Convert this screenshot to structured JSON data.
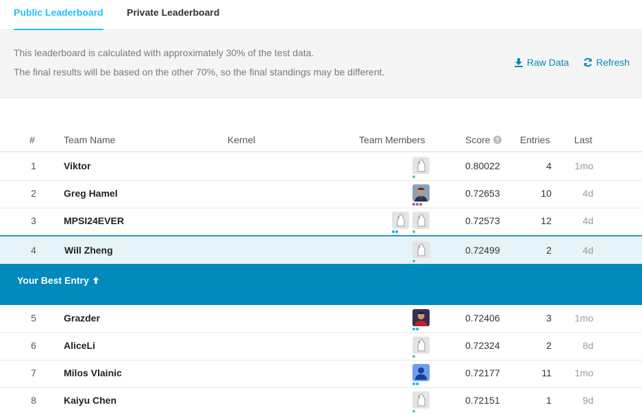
{
  "tabs": {
    "public": "Public Leaderboard",
    "private": "Private Leaderboard"
  },
  "info": {
    "line1": "This leaderboard is calculated with approximately 30% of the test data.",
    "line2": "The final results will be based on the other 70%, so the final standings may be different.",
    "raw_data": "Raw Data",
    "refresh": "Refresh"
  },
  "columns": {
    "rank": "#",
    "team_name": "Team Name",
    "kernel": "Kernel",
    "team_members": "Team Members",
    "score": "Score",
    "entries": "Entries",
    "last": "Last"
  },
  "best_entry_label": "Your Best Entry",
  "rows": [
    {
      "rank": "1",
      "name": "Viktor",
      "score": "0.80022",
      "entries": "4",
      "last": "1mo"
    },
    {
      "rank": "2",
      "name": "Greg Hamel",
      "score": "0.72653",
      "entries": "10",
      "last": "4d"
    },
    {
      "rank": "3",
      "name": "MPSI24EVER",
      "score": "0.72573",
      "entries": "12",
      "last": "4d"
    },
    {
      "rank": "4",
      "name": "Will Zheng",
      "score": "0.72499",
      "entries": "2",
      "last": "4d"
    },
    {
      "rank": "5",
      "name": "Grazder",
      "score": "0.72406",
      "entries": "3",
      "last": "1mo"
    },
    {
      "rank": "6",
      "name": "AliceLi",
      "score": "0.72324",
      "entries": "2",
      "last": "8d"
    },
    {
      "rank": "7",
      "name": "Milos Vlainic",
      "score": "0.72177",
      "entries": "11",
      "last": "1mo"
    },
    {
      "rank": "8",
      "name": "Kaiyu Chen",
      "score": "0.72151",
      "entries": "1",
      "last": "9d"
    }
  ],
  "colors": {
    "accent": "#20beff",
    "link": "#008abc",
    "best_bar": "#008abc",
    "tier_novice": "#5ac995",
    "tier_contributor": "#00bbff",
    "tier_expert": "#95628f"
  }
}
